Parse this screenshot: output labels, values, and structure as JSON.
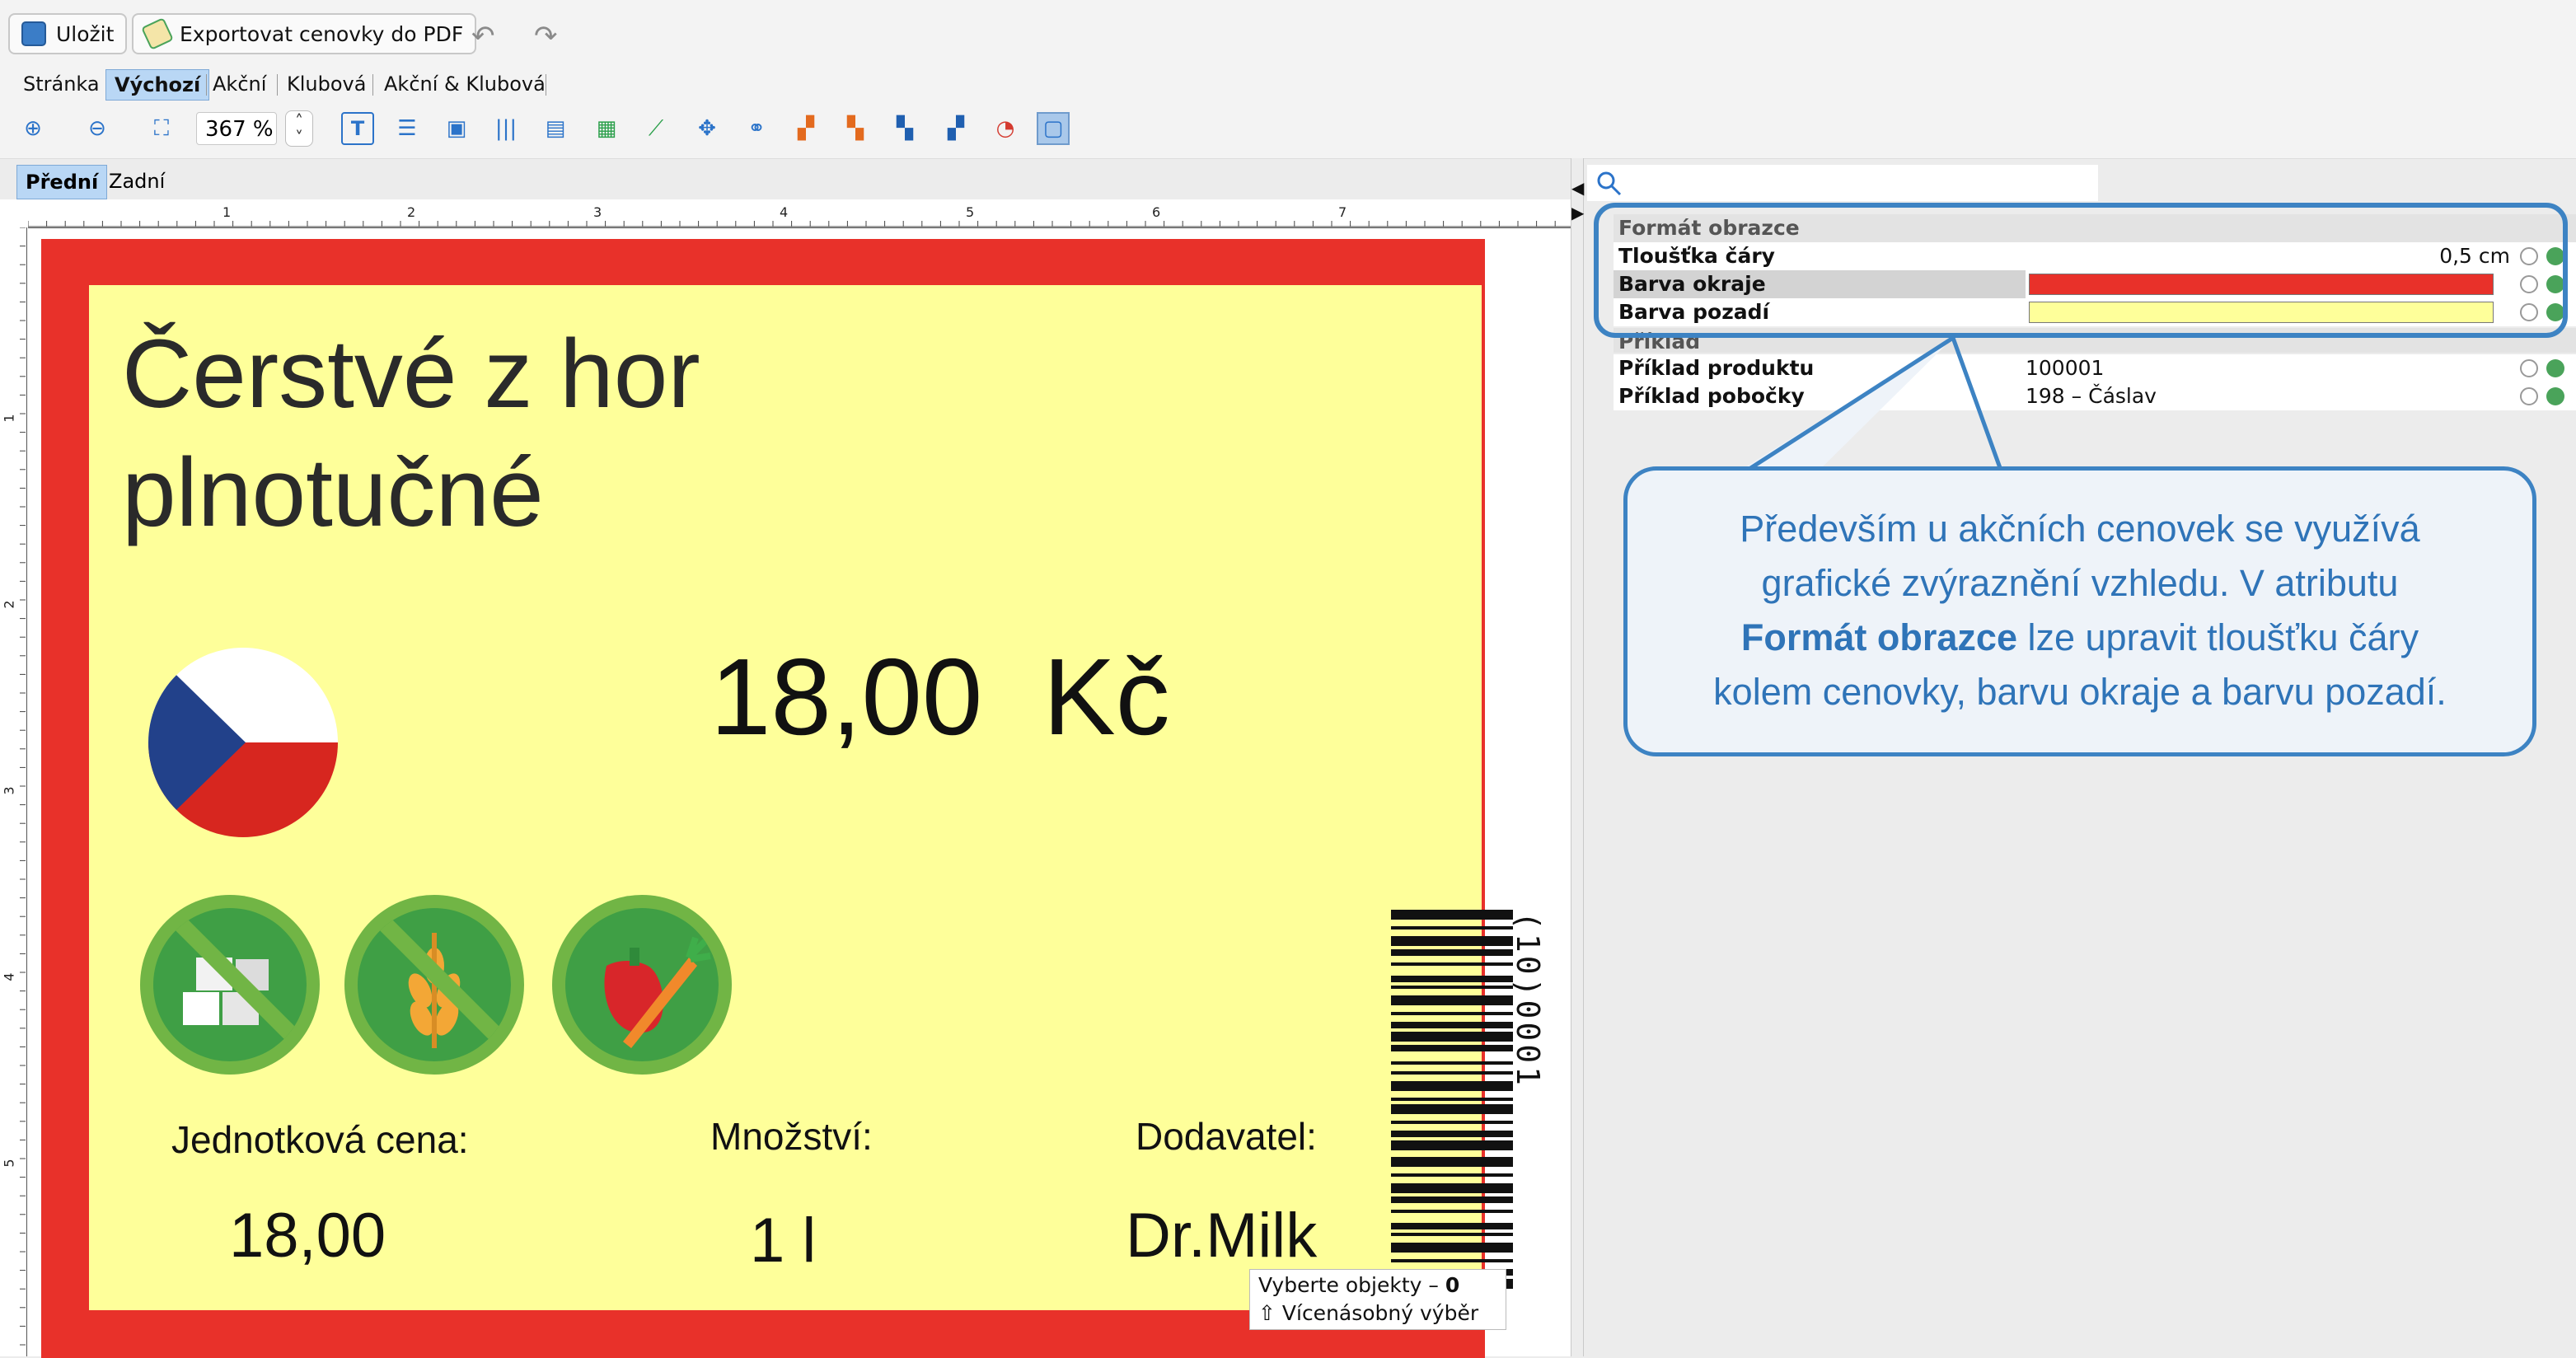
{
  "toolbar": {
    "save_label": "Uložit",
    "export_label": "Exportovat cenovky do PDF",
    "zoom_value": "367 %"
  },
  "tabs": [
    "Stránka",
    "Výchozí",
    "Akční",
    "Klubová",
    "Akční & Klubová"
  ],
  "side_tabs": [
    "Přední",
    "Zadní"
  ],
  "ruler": {
    "horizontal": [
      "1",
      "2",
      "3",
      "4",
      "5",
      "6",
      "7"
    ],
    "vertical": [
      "1",
      "2",
      "3",
      "4",
      "5"
    ]
  },
  "label": {
    "title_line1": "Čerstvé z hor",
    "title_line2": "plnotučné",
    "price": "18,00  Kč",
    "barcode_text": "(10)0001",
    "unit_price_label": "Jednotková cena:",
    "unit_price_value": "18,00",
    "quantity_label": "Množství:",
    "quantity_value": "1 l",
    "supplier_label": "Dodavatel:",
    "supplier_value": "Dr.Milk",
    "border_color": "#e8312a",
    "background_color": "#feff9a"
  },
  "status": {
    "select_objects": "Vyberte objekty – ",
    "count": "0",
    "multi_select": "⇧ Vícenásobný výběr"
  },
  "properties": {
    "group1_title": "Formát obrazce",
    "line_width_label": "Tloušťka čáry",
    "line_width_value": "0,5 cm",
    "border_color_label": "Barva okraje",
    "background_label": "Barva pozadí",
    "group2_title": "Příklad",
    "product_label": "Příklad produktu",
    "product_value": "100001",
    "branch_label": "Příklad pobočky",
    "branch_value": "198 – Čáslav"
  },
  "callout": {
    "line1": "Především u akčních cenovek se využívá",
    "line2": "grafické zvýraznění vzhledu. V atributu",
    "bold": "Formát obrazce",
    "line3_rest": " lze upravit tloušťku čáry",
    "line4": "kolem cenovky, barvu okraje a barvu pozadí."
  }
}
